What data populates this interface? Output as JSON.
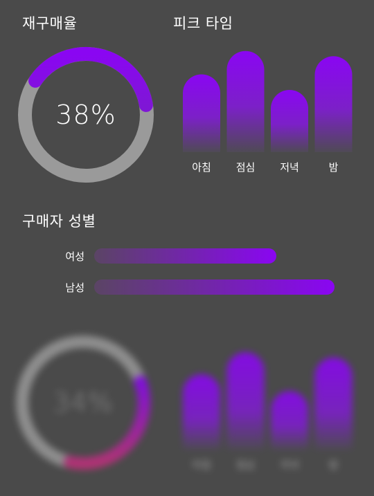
{
  "sections": {
    "repurchase_title": "재구매율",
    "peak_title": "피크 타임",
    "gender_title": "구매자 성별"
  },
  "colors": {
    "background": "#4a4a4a",
    "accent": "#8a06f2",
    "track": "#9a9a9a",
    "pink": "#c0307a"
  },
  "chart_data": [
    {
      "type": "pie",
      "title": "재구매율",
      "values": [
        38
      ],
      "label": "38%",
      "max": 100
    },
    {
      "type": "bar",
      "title": "피크 타임",
      "categories": [
        "아침",
        "점심",
        "저녁",
        "밤"
      ],
      "values": [
        60,
        78,
        48,
        74
      ],
      "ylim": [
        0,
        80
      ]
    },
    {
      "type": "bar",
      "title": "구매자 성별",
      "orientation": "horizontal",
      "categories": [
        "여성",
        "남성"
      ],
      "values": [
        75,
        99
      ],
      "xlim": [
        0,
        100
      ]
    },
    {
      "type": "pie",
      "values": [
        34
      ],
      "label": "34%",
      "max": 100,
      "blurred": true
    },
    {
      "type": "bar",
      "categories": [
        "아침",
        "점심",
        "저녁",
        "밤"
      ],
      "values": [
        58,
        75,
        45,
        71
      ],
      "ylim": [
        0,
        80
      ],
      "blurred": true
    }
  ]
}
